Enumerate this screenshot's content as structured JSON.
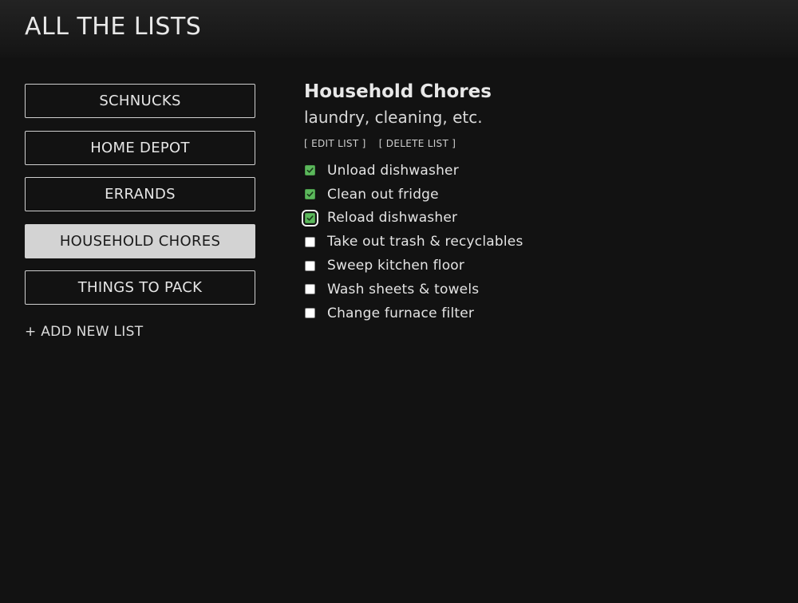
{
  "app": {
    "title": "ALL THE LISTS"
  },
  "sidebar": {
    "lists": [
      {
        "label": "SCHNUCKS",
        "active": false
      },
      {
        "label": "HOME DEPOT",
        "active": false
      },
      {
        "label": "ERRANDS",
        "active": false
      },
      {
        "label": "HOUSEHOLD CHORES",
        "active": true
      },
      {
        "label": "THINGS TO PACK",
        "active": false
      }
    ],
    "add_label": "+ ADD NEW LIST"
  },
  "main": {
    "title": "Household Chores",
    "description": "laundry, cleaning, etc.",
    "edit_label": "[ EDIT LIST ]",
    "delete_label": "[ DELETE LIST ]",
    "items": [
      {
        "label": "Unload dishwasher",
        "checked": true
      },
      {
        "label": "Clean out fridge",
        "checked": true
      },
      {
        "label": "Reload dishwasher",
        "checked": true
      },
      {
        "label": "Take out trash & recyclables",
        "checked": false
      },
      {
        "label": "Sweep kitchen floor",
        "checked": false
      },
      {
        "label": "Wash sheets & towels",
        "checked": false
      },
      {
        "label": "Change furnace filter",
        "checked": false
      }
    ]
  },
  "colors": {
    "background": "#121212",
    "checked": "#5cb85c",
    "active_button": "#d3d3d3"
  },
  "icons": {
    "checkmark": "checkmark-icon"
  }
}
